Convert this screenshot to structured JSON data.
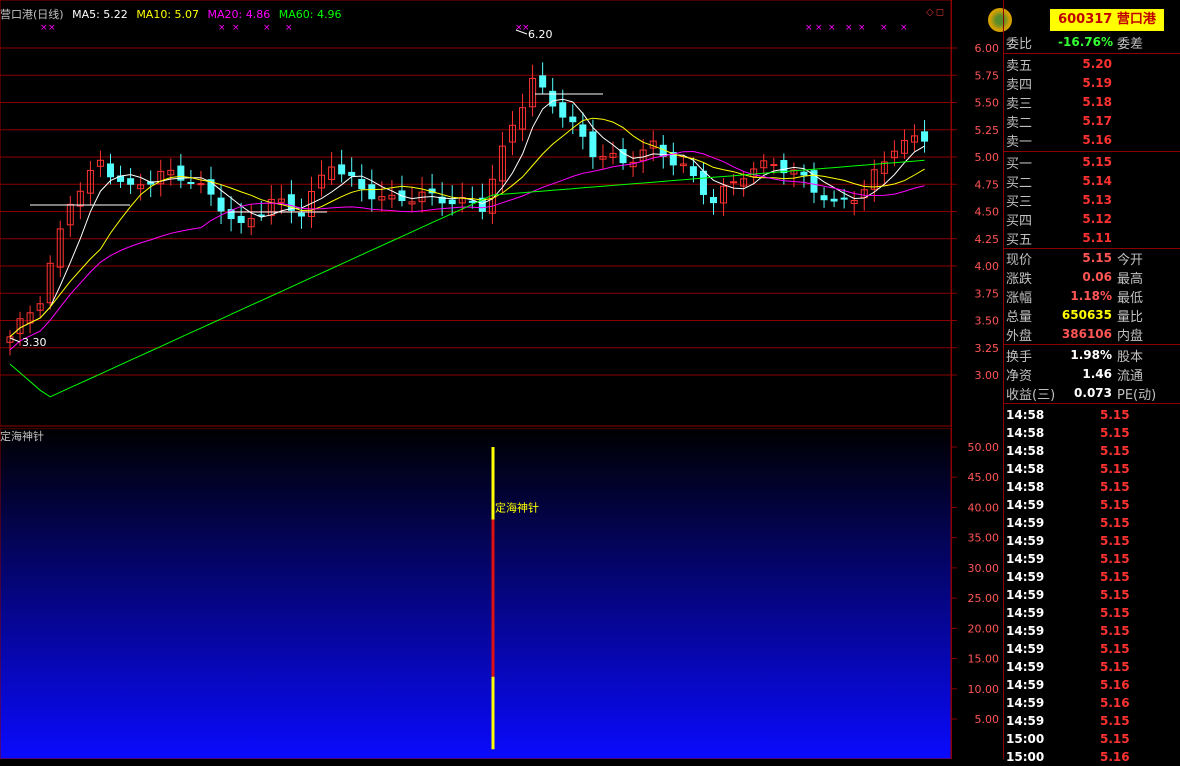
{
  "stock": {
    "code": "600317",
    "name": "营口港",
    "title_line": "营口港(日线)"
  },
  "ma_legend": [
    {
      "label": "MA5: 5.22",
      "color": "#ffffff"
    },
    {
      "label": "MA10: 5.07",
      "color": "#ffff00"
    },
    {
      "label": "MA20: 4.86",
      "color": "#ff00ff"
    },
    {
      "label": "MA60: 4.96",
      "color": "#00ff00"
    }
  ],
  "price_axis": [
    "6.00",
    "5.75",
    "5.50",
    "5.25",
    "5.00",
    "4.75",
    "4.50",
    "4.25",
    "4.00",
    "3.75",
    "3.50",
    "3.25",
    "3.00"
  ],
  "price_annotations": {
    "high": "6.20",
    "low": "3.30"
  },
  "indicator": {
    "name": "定海神针",
    "signal_label": "定海神针",
    "axis": [
      "50.00",
      "45.00",
      "40.00",
      "35.00",
      "30.00",
      "25.00",
      "20.00",
      "15.00",
      "10.00",
      "5.00"
    ]
  },
  "weibi": {
    "label": "委比",
    "value": "-16.76%",
    "diff_label": "委差"
  },
  "asks": [
    {
      "label": "卖五",
      "price": "5.20"
    },
    {
      "label": "卖四",
      "price": "5.19"
    },
    {
      "label": "卖三",
      "price": "5.18"
    },
    {
      "label": "卖二",
      "price": "5.17"
    },
    {
      "label": "卖一",
      "price": "5.16"
    }
  ],
  "bids": [
    {
      "label": "买一",
      "price": "5.15"
    },
    {
      "label": "买二",
      "price": "5.14"
    },
    {
      "label": "买三",
      "price": "5.13"
    },
    {
      "label": "买四",
      "price": "5.12"
    },
    {
      "label": "买五",
      "price": "5.11"
    }
  ],
  "quote": [
    {
      "label": "现价",
      "value": "5.15",
      "label2": "今开",
      "color": "#ff5555"
    },
    {
      "label": "涨跌",
      "value": "0.06",
      "label2": "最高",
      "color": "#ff5555"
    },
    {
      "label": "涨幅",
      "value": "1.18%",
      "label2": "最低",
      "color": "#ff5555"
    },
    {
      "label": "总量",
      "value": "650635",
      "label2": "量比",
      "color": "#ffff00"
    },
    {
      "label": "外盘",
      "value": "386106",
      "label2": "内盘",
      "color": "#ff5555"
    }
  ],
  "fundamentals": [
    {
      "label": "换手",
      "value": "1.98%",
      "label2": "股本"
    },
    {
      "label": "净资",
      "value": "1.46",
      "label2": "流通"
    },
    {
      "label": "收益(三)",
      "value": "0.073",
      "label2": "PE(动)"
    }
  ],
  "ticks": [
    {
      "time": "14:58",
      "price": "5.15"
    },
    {
      "time": "14:58",
      "price": "5.15"
    },
    {
      "time": "14:58",
      "price": "5.15"
    },
    {
      "time": "14:58",
      "price": "5.15"
    },
    {
      "time": "14:58",
      "price": "5.15"
    },
    {
      "time": "14:59",
      "price": "5.15"
    },
    {
      "time": "14:59",
      "price": "5.15"
    },
    {
      "time": "14:59",
      "price": "5.15"
    },
    {
      "time": "14:59",
      "price": "5.15"
    },
    {
      "time": "14:59",
      "price": "5.15"
    },
    {
      "time": "14:59",
      "price": "5.15"
    },
    {
      "time": "14:59",
      "price": "5.15"
    },
    {
      "time": "14:59",
      "price": "5.15"
    },
    {
      "time": "14:59",
      "price": "5.15"
    },
    {
      "time": "14:59",
      "price": "5.15"
    },
    {
      "time": "14:59",
      "price": "5.16"
    },
    {
      "time": "14:59",
      "price": "5.16"
    },
    {
      "time": "14:59",
      "price": "5.15"
    },
    {
      "time": "15:00",
      "price": "5.15"
    },
    {
      "time": "15:00",
      "price": "5.16"
    }
  ],
  "colors": {
    "up": "#ff3232",
    "down": "#54ffff",
    "grid": "#8b0000",
    "ma5": "#ffffff",
    "ma10": "#ffff00",
    "ma20": "#ff00ff",
    "ma60": "#00ff00"
  }
}
